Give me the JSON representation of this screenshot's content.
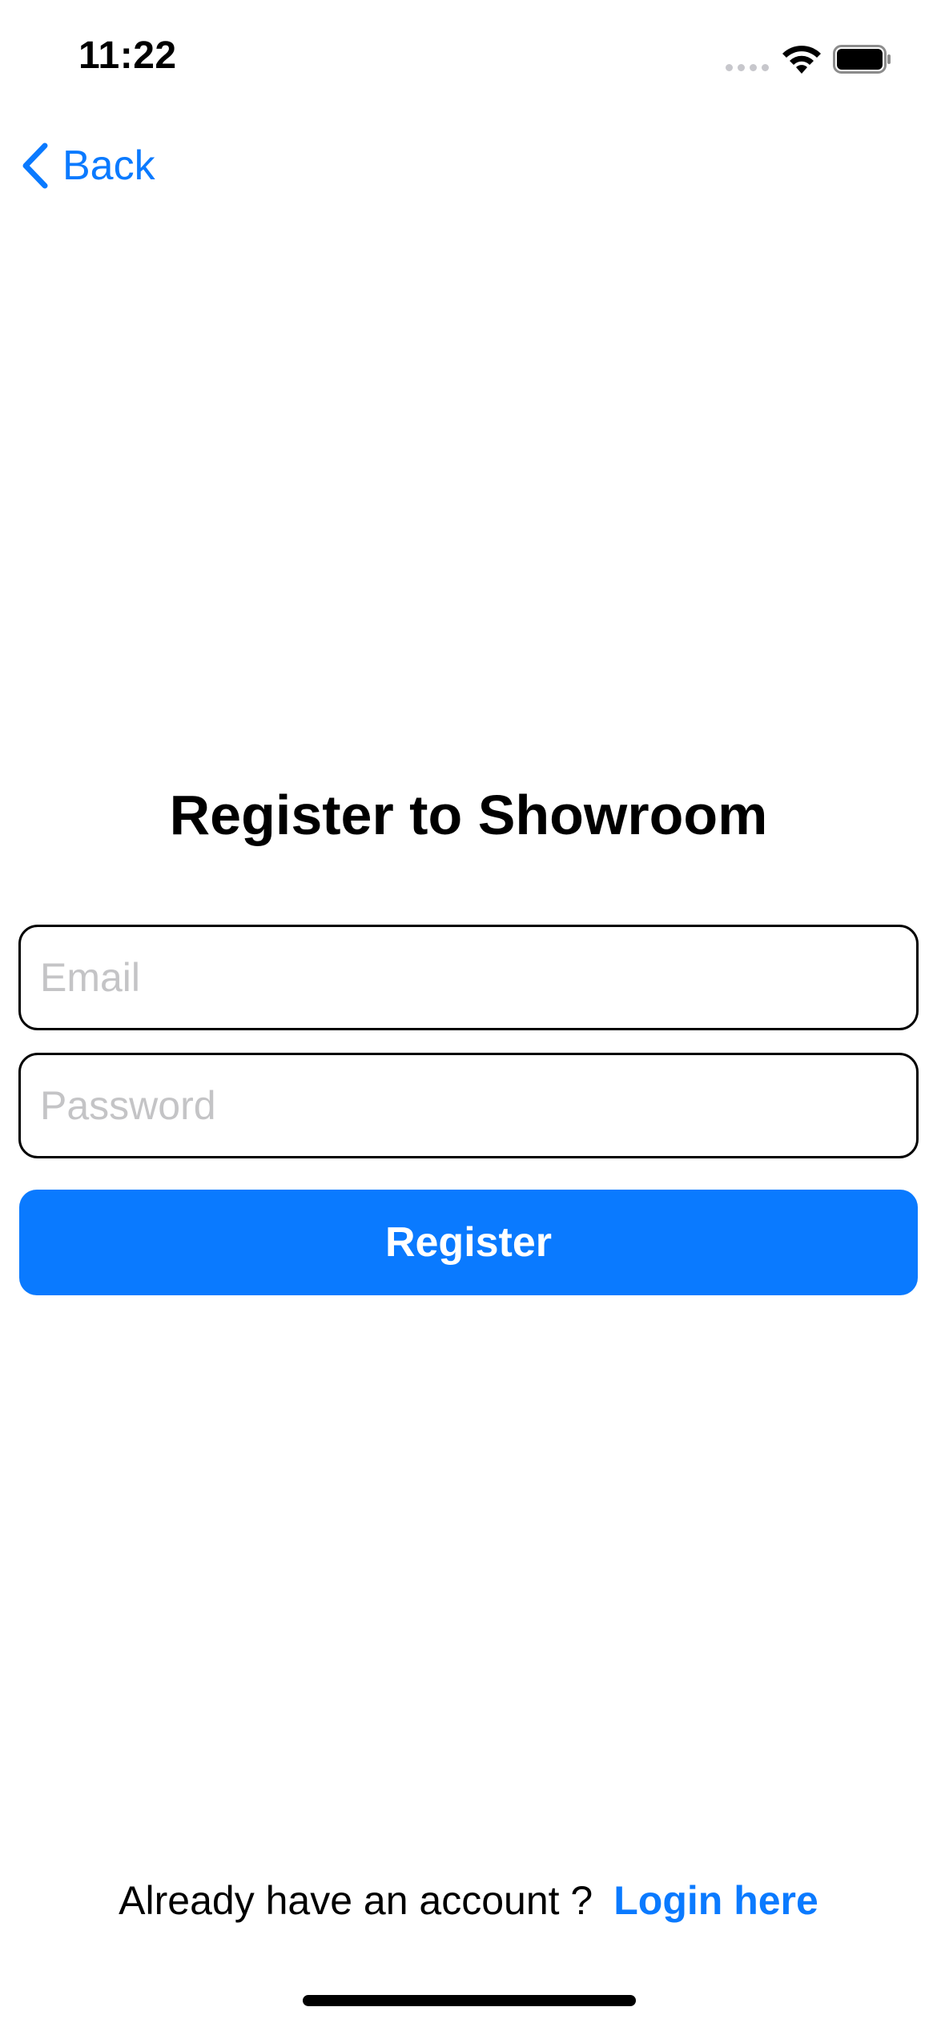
{
  "status_bar": {
    "time": "11:22"
  },
  "nav": {
    "back_label": "Back"
  },
  "title": "Register to Showroom",
  "form": {
    "email_placeholder": "Email",
    "email_value": "",
    "password_placeholder": "Password",
    "password_value": "",
    "register_label": "Register"
  },
  "footer": {
    "prompt": "Already have an account ?",
    "login_label": "Login here"
  },
  "colors": {
    "accent": "#0a7aff",
    "placeholder": "#c4c4c6",
    "field_border": "#000000"
  },
  "icons": [
    "chevron-left-icon",
    "cellular-signal-icon",
    "wifi-icon",
    "battery-icon"
  ]
}
